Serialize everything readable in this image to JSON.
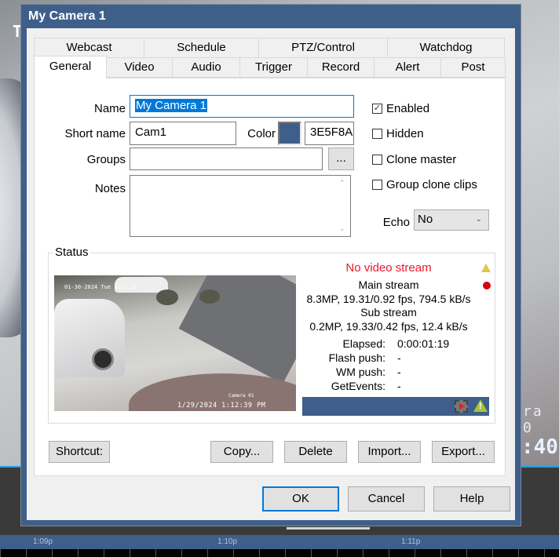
{
  "window": {
    "title": "My Camera 1"
  },
  "tabs": {
    "row1": [
      {
        "label": "Webcast"
      },
      {
        "label": "Schedule"
      },
      {
        "label": "PTZ/Control"
      },
      {
        "label": "Watchdog"
      }
    ],
    "row2": [
      {
        "label": "General",
        "active": true
      },
      {
        "label": "Video"
      },
      {
        "label": "Audio"
      },
      {
        "label": "Trigger"
      },
      {
        "label": "Record"
      },
      {
        "label": "Alert"
      },
      {
        "label": "Post"
      }
    ]
  },
  "general": {
    "name_label": "Name",
    "name_value": "My Camera 1",
    "short_name_label": "Short name",
    "short_name_value": "Cam1",
    "color_label": "Color",
    "color_hex": "3E5F8A",
    "color_swatch": "#3e5f8a",
    "groups_label": "Groups",
    "groups_value": "",
    "groups_browse": "...",
    "notes_label": "Notes",
    "notes_value": "",
    "checkboxes": [
      {
        "label": "Enabled",
        "checked": true
      },
      {
        "label": "Hidden",
        "checked": false
      },
      {
        "label": "Clone master",
        "checked": false
      },
      {
        "label": "Group clone clips",
        "checked": false
      }
    ],
    "echo_label": "Echo",
    "echo_value": "No"
  },
  "status": {
    "title": "Status",
    "alert": "No video stream",
    "main_stream_label": "Main stream",
    "main_stream_value": "8.3MP, 19.31/0.92 fps,  794.5 kB/s",
    "sub_stream_label": "Sub stream",
    "sub_stream_value": "0.2MP, 19.33/0.42 fps,   12.4 kB/s",
    "rows": [
      {
        "key": "Elapsed:",
        "value": "0:00:01:19"
      },
      {
        "key": "Flash push:",
        "value": "-"
      },
      {
        "key": "WM push:",
        "value": "-"
      },
      {
        "key": "GetEvents:",
        "value": "-"
      }
    ],
    "thumbnail": {
      "osd_top": "01-30-2024 Tue 1:12:37",
      "osd_camera": "Camera 01",
      "osd_bottom": "1/29/2024 1:12:39 PM"
    },
    "icons": [
      "warning-icon",
      "recording-dot-icon",
      "video-clip-icon",
      "alert-triangle-icon"
    ]
  },
  "page_buttons": {
    "shortcut": "Shortcut:",
    "copy": "Copy...",
    "delete": "Delete",
    "import": "Import...",
    "export": "Export..."
  },
  "dialog_buttons": {
    "ok": "OK",
    "cancel": "Cancel",
    "help": "Help"
  },
  "background": {
    "osd_right_top": "ra 0",
    "osd_right_bottom": ":40",
    "osd_left": "T",
    "timeline": [
      "1:09p",
      "1:10p",
      "1:11p"
    ]
  },
  "colors": {
    "accent": "#3e5f8a",
    "focus": "#0078d7",
    "error": "#e8192c"
  }
}
